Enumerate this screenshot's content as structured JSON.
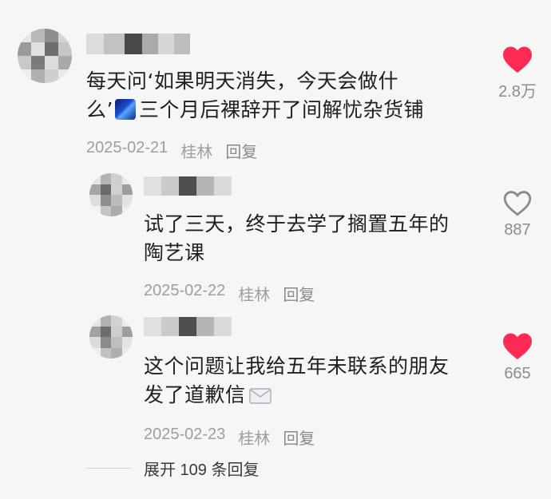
{
  "comments": [
    {
      "text_line1": "每天问‘如果明天消失，今天会做什",
      "text_line2_prefix": "么’",
      "text_line2_suffix": "三个月后裸辞开了间解忧杂货铺",
      "date": "2025-02-21",
      "location": "桂林",
      "reply_label": "回复",
      "like_count": "2.8万",
      "liked": true
    },
    {
      "text_line1": "试了三天，终于去学了搁置五年的",
      "text_line2": "陶艺课",
      "date": "2025-02-22",
      "location": "桂林",
      "reply_label": "回复",
      "like_count": "887",
      "liked": false
    },
    {
      "text_line1": "这个问题让我给五年未联系的朋友",
      "text_line2": "发了道歉信",
      "date": "2025-02-23",
      "location": "桂林",
      "reply_label": "回复",
      "like_count": "665",
      "liked": true
    }
  ],
  "expand_replies_label": "展开 109 条回复",
  "colors": {
    "liked_heart": "#fe2c55",
    "outline_heart": "#8a8a8a",
    "meta_text": "#9e9e9e"
  },
  "icons": [
    "heart-filled-icon",
    "heart-outline-icon",
    "stars-emoji-icon",
    "envelope-icon"
  ]
}
